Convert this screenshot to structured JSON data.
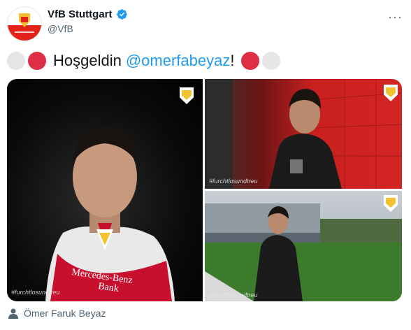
{
  "tweet": {
    "display_name": "VfB Stuttgart",
    "handle": "@VfB",
    "text_before": "Hoşgeldin",
    "mention": "@omerfabeyaz",
    "text_after": "!",
    "more_label": "···"
  },
  "media": {
    "hashtag": "#furchtlosundtreu",
    "sponsor_line1": "Mercedes-Benz",
    "sponsor_line2": "Bank"
  },
  "tagged": {
    "name": "Ömer Faruk Beyaz"
  },
  "colors": {
    "brand_red": "#e32219",
    "link_blue": "#1d9bf0",
    "verified_blue": "#1d9bf0"
  }
}
